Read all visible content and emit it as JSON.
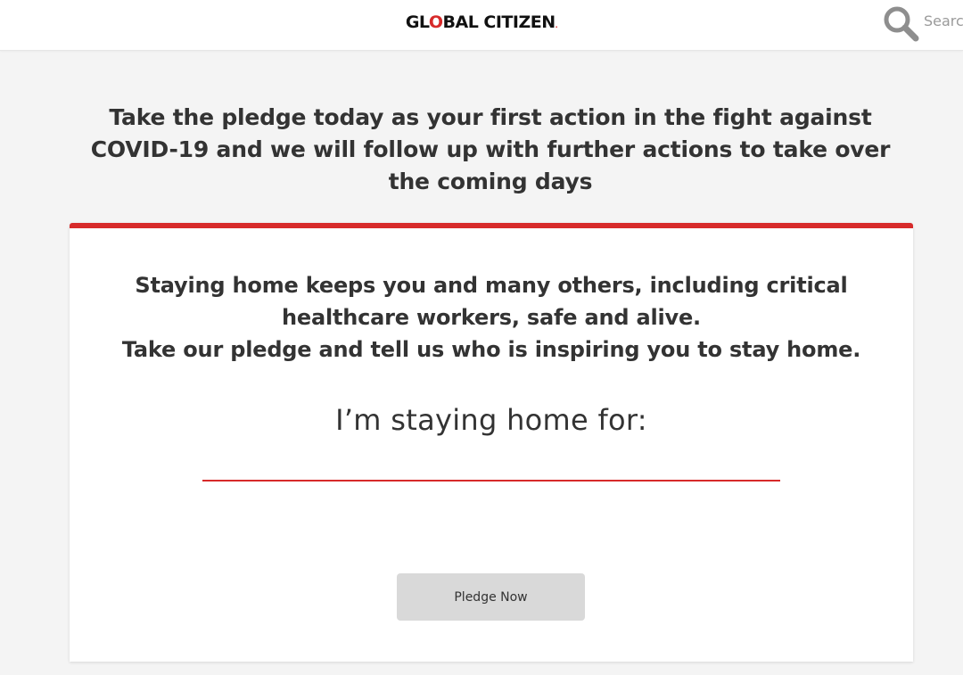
{
  "header": {
    "logo_part1": "GL",
    "logo_accent": "O",
    "logo_part2": "BAL CITIZEN",
    "logo_dot": ".",
    "search_placeholder": "Search"
  },
  "intro": {
    "text": "Take the pledge today as your first action in the fight against\nCOVID-19 and we will follow up with further actions to take over\nthe coming days"
  },
  "card": {
    "lines": [
      "Staying home keeps you and many others, including critical",
      "healthcare workers, safe and alive.",
      "Take our pledge and tell us who is inspiring you to stay home."
    ],
    "pledge_label": "I’m staying home for:",
    "input_value": "",
    "button_label": "Pledge Now"
  },
  "colors": {
    "accent": "#d72a2a",
    "background": "#f4f4f4",
    "card": "#ffffff",
    "button": "#d9d9d9",
    "text": "#333333"
  },
  "icons": {
    "search": "search-icon"
  }
}
